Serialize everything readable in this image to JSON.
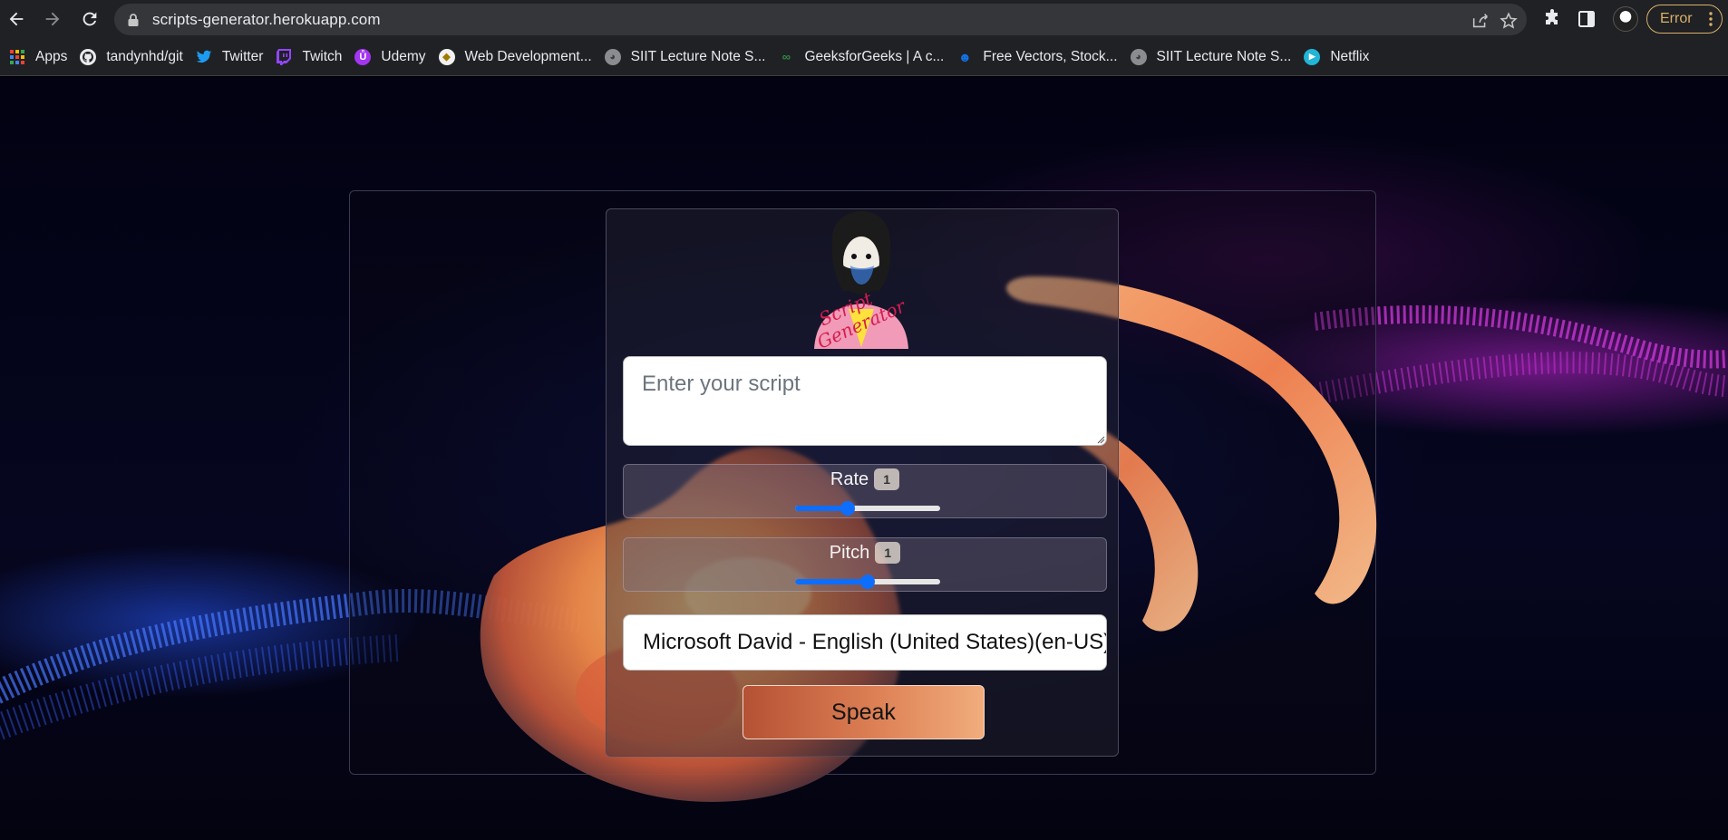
{
  "browser": {
    "url": "scripts-generator.herokuapp.com",
    "profile_status": "Error",
    "bookmarks": [
      {
        "label": "Apps",
        "icon": "apps-grid-icon"
      },
      {
        "label": "tandynhd/git",
        "icon": "github-icon"
      },
      {
        "label": "Twitter",
        "icon": "twitter-icon"
      },
      {
        "label": "Twitch",
        "icon": "twitch-icon"
      },
      {
        "label": "Udemy",
        "icon": "udemy-icon"
      },
      {
        "label": "Web Development...",
        "icon": "bookmark-site-icon"
      },
      {
        "label": "SIIT Lecture Note S...",
        "icon": "globe-icon"
      },
      {
        "label": "GeeksforGeeks | A c...",
        "icon": "geeksforgeeks-icon"
      },
      {
        "label": "Free Vectors, Stock...",
        "icon": "freepik-icon"
      },
      {
        "label": "SIIT Lecture Note S...",
        "icon": "globe-icon"
      },
      {
        "label": "Netflix",
        "icon": "netflix-icon"
      }
    ]
  },
  "app": {
    "logo_text": "Script Generator",
    "script_placeholder": "Enter your script",
    "script_value": "",
    "rate": {
      "label": "Rate",
      "value": "1",
      "level": 0.36
    },
    "pitch": {
      "label": "Pitch",
      "value": "1",
      "level": 0.5
    },
    "voice_selected": "Microsoft David - English (United States)(en-US)",
    "speak_label": "Speak"
  },
  "colors": {
    "accent_blue": "#0d6efd",
    "speak_gradient_start": "#b55134",
    "speak_gradient_end": "#f1ad7d",
    "browser_chrome": "#202124",
    "error_pill": "#d7b06a"
  }
}
